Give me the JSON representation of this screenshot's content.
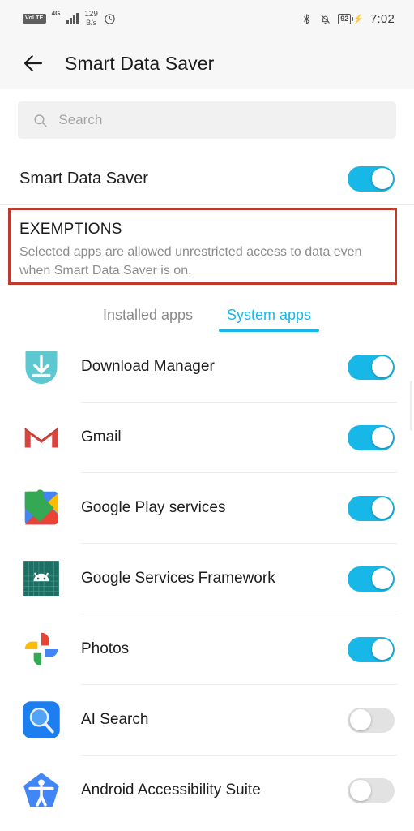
{
  "status_bar": {
    "volte_label": "VoLTE",
    "network_gen": "4G",
    "net_speed_value": "129",
    "net_speed_unit": "B/s",
    "icons": [
      "volte-icon",
      "signal-icon",
      "data-saver-icon",
      "bluetooth-icon",
      "mute-icon",
      "battery-icon"
    ],
    "battery_level": "92",
    "clock": "7:02"
  },
  "app_bar": {
    "back_label": "←",
    "title": "Smart Data Saver"
  },
  "search": {
    "placeholder": "Search",
    "value": ""
  },
  "master_switch": {
    "label": "Smart Data Saver",
    "state": "on"
  },
  "exemptions": {
    "heading": "EXEMPTIONS",
    "description": "Selected apps are allowed unrestricted access to data even when Smart Data Saver is on.",
    "highlight_color": "#c0392b"
  },
  "tabs": [
    {
      "label": "Installed apps",
      "active": false
    },
    {
      "label": "System apps",
      "active": true
    }
  ],
  "accent_color": "#17b8e8",
  "apps": [
    {
      "name": "Download Manager",
      "icon": "download-manager-icon",
      "state": "on"
    },
    {
      "name": "Gmail",
      "icon": "gmail-icon",
      "state": "on"
    },
    {
      "name": "Google Play services",
      "icon": "google-play-services-icon",
      "state": "on"
    },
    {
      "name": "Google Services Framework",
      "icon": "google-services-framework-icon",
      "state": "on"
    },
    {
      "name": "Photos",
      "icon": "google-photos-icon",
      "state": "on"
    },
    {
      "name": "AI Search",
      "icon": "ai-search-icon",
      "state": "off"
    },
    {
      "name": "Android Accessibility Suite",
      "icon": "android-accessibility-icon",
      "state": "off"
    }
  ]
}
